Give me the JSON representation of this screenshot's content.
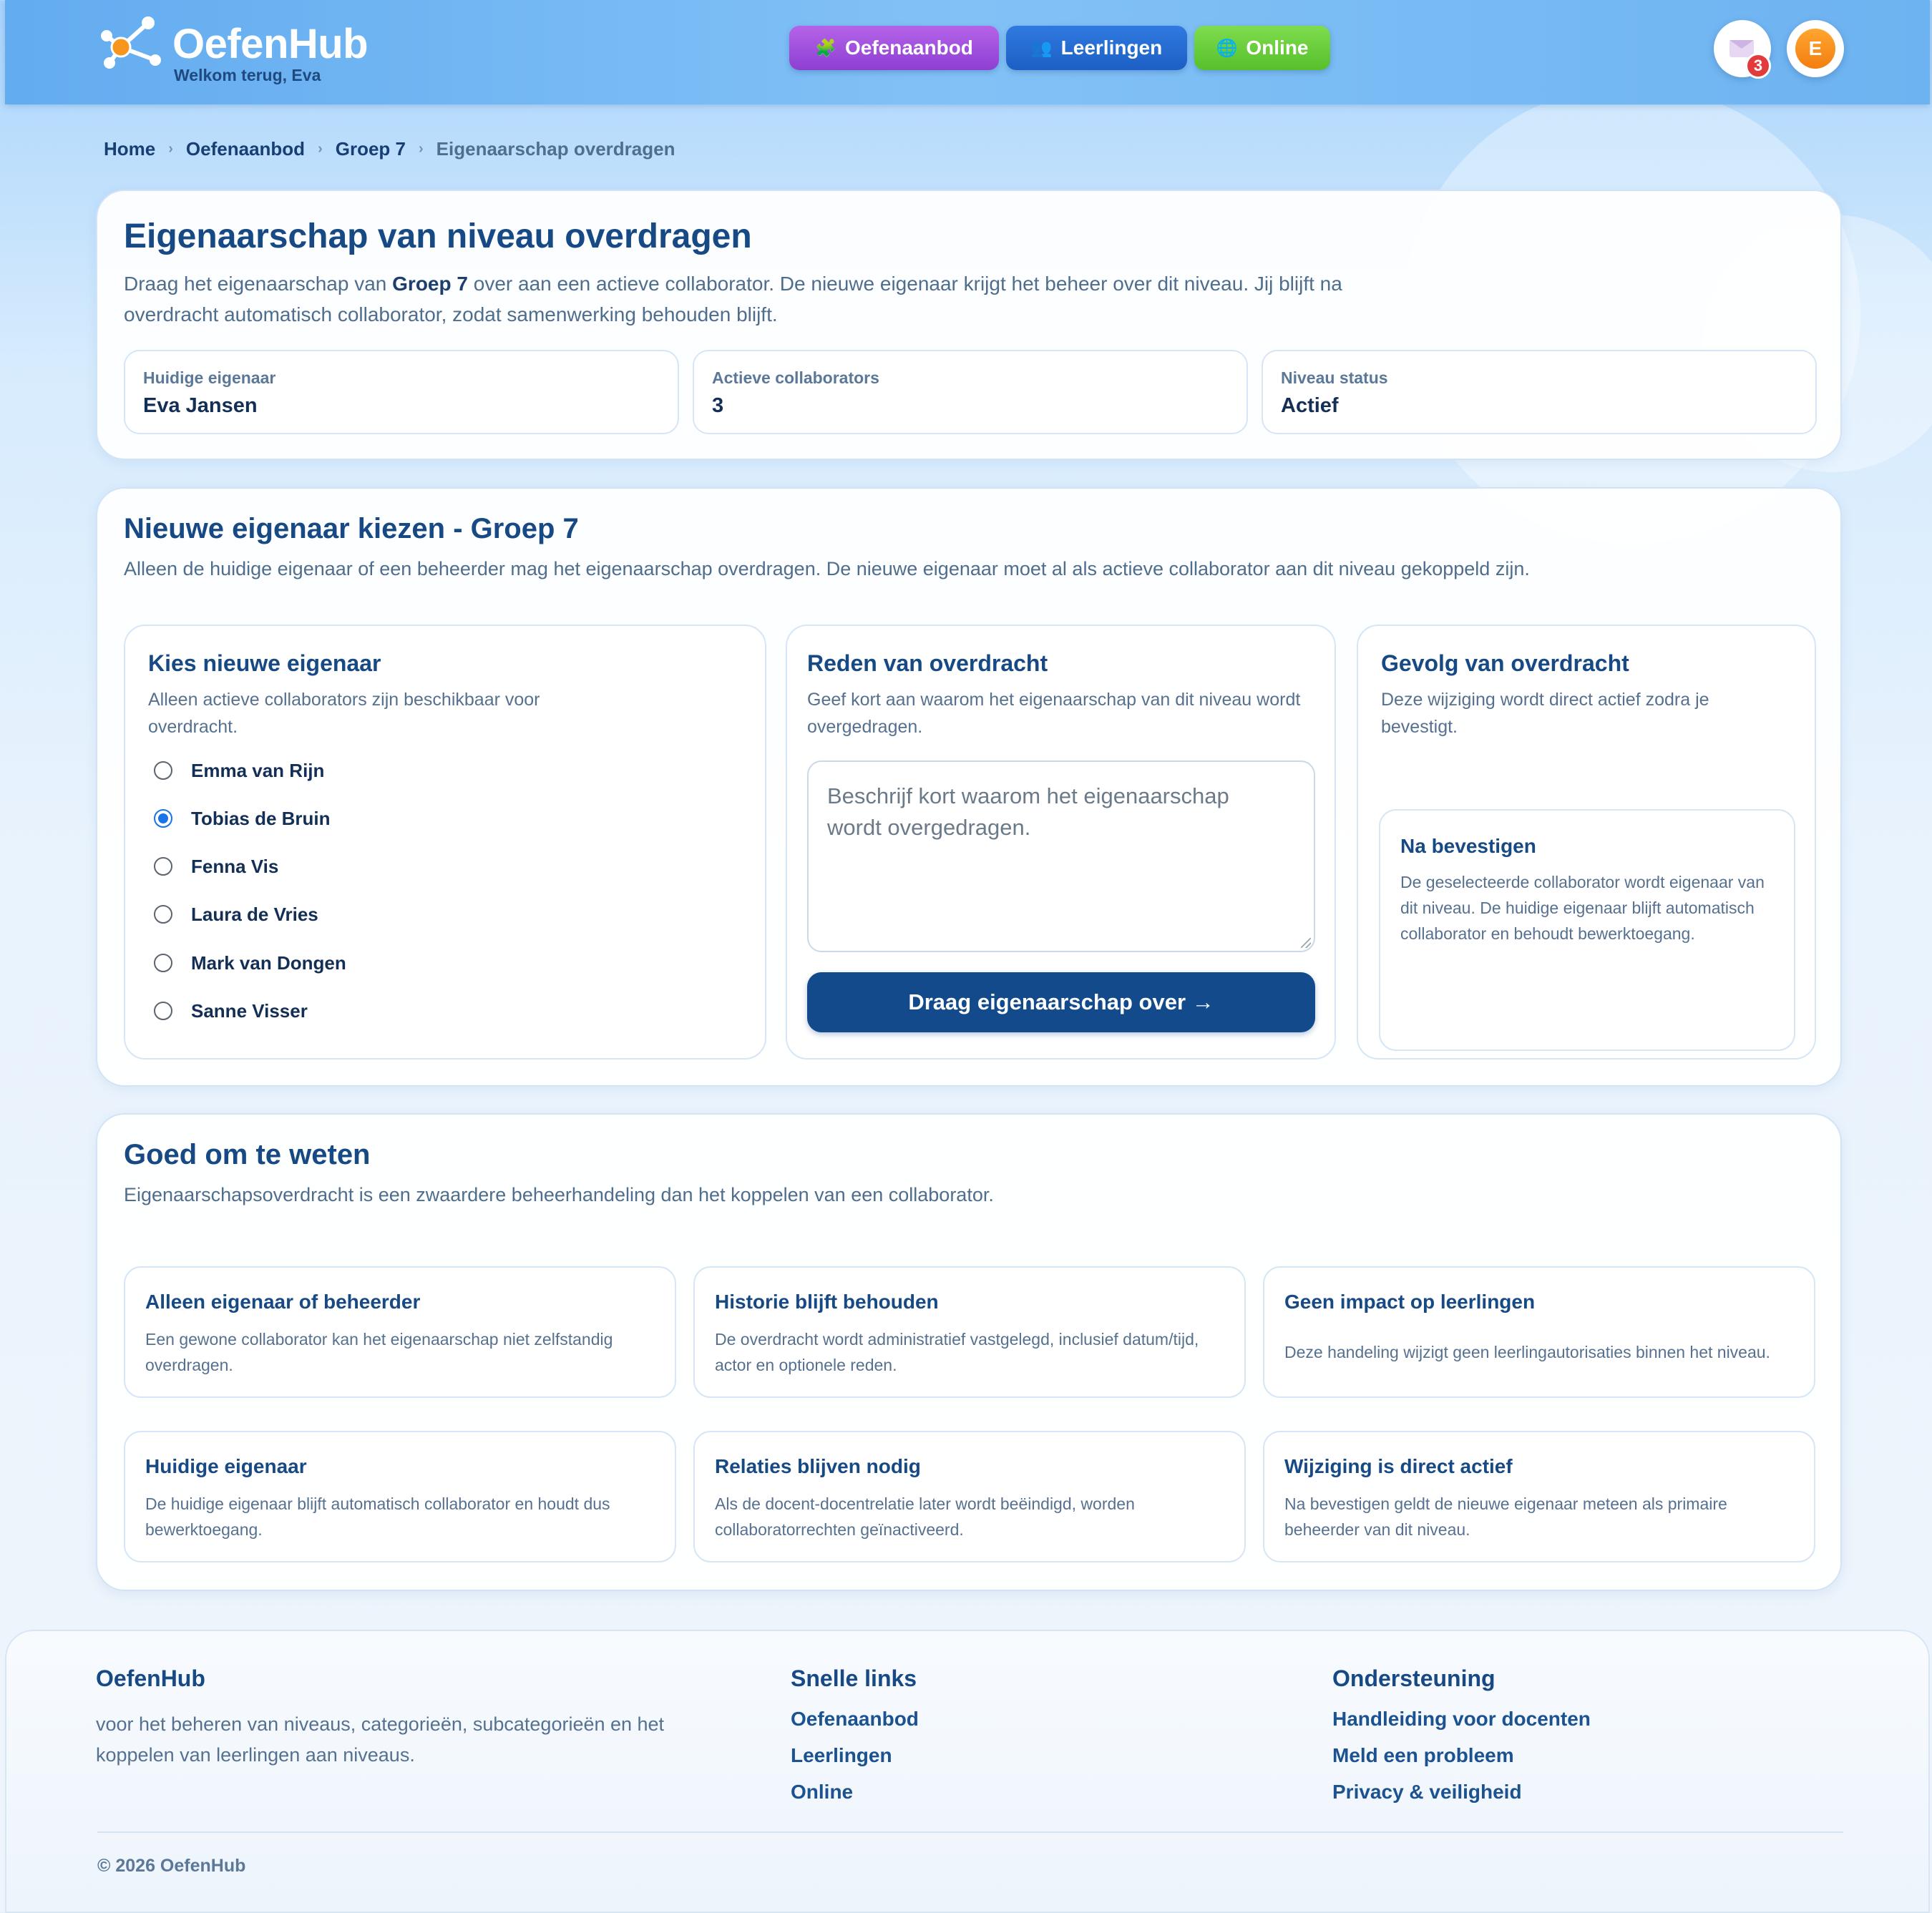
{
  "app": {
    "brand": "OefenHub",
    "welcome": "Welkom terug, Eva"
  },
  "nav": {
    "items": [
      {
        "label": "Oefenaanbod",
        "icon": "puzzle-icon",
        "color": "#a24fdd"
      },
      {
        "label": "Leerlingen",
        "icon": "users-icon",
        "color": "#2368d3"
      },
      {
        "label": "Online",
        "icon": "globe-icon",
        "color": "#66c937"
      }
    ],
    "mail_badge": "3",
    "avatar_initial": "E"
  },
  "breadcrumb": [
    "Home",
    "Oefenaanbod",
    "Groep 7",
    "Eigenaarschap overdragen"
  ],
  "overview": {
    "title": "Eigenaarschap van niveau overdragen",
    "intro_before": "Draag het eigenaarschap van ",
    "intro_bold": "Groep 7",
    "intro_after": " over aan een actieve collaborator. De nieuwe eigenaar krijgt het beheer over dit niveau. Jij blijft na overdracht automatisch collaborator, zodat samenwerking behouden blijft.",
    "stats": [
      {
        "label": "Huidige eigenaar",
        "value": "Eva Jansen"
      },
      {
        "label": "Actieve collaborators",
        "value": "3"
      },
      {
        "label": "Niveau status",
        "value": "Actief"
      }
    ]
  },
  "transfer": {
    "title": "Nieuwe eigenaar kiezen - Groep 7",
    "lead": "Alleen de huidige eigenaar of een beheerder mag het eigenaarschap overdragen. De nieuwe eigenaar moet al als actieve collaborator aan dit niveau gekoppeld zijn.",
    "choose": {
      "title": "Kies nieuwe eigenaar",
      "desc": "Alleen actieve collaborators zijn beschikbaar voor overdracht.",
      "selected": "Tobias de Bruin",
      "options": [
        "Emma van Rijn",
        "Tobias de Bruin",
        "Fenna Vis",
        "Laura de Vries",
        "Mark van Dongen",
        "Sanne Visser"
      ]
    },
    "reason": {
      "title": "Reden van overdracht",
      "desc": "Geef kort aan waarom het eigenaarschap van dit niveau wordt overgedragen.",
      "placeholder": "Beschrijf kort waarom het eigenaarschap wordt overgedragen.",
      "value": "",
      "button": "Draag eigenaarschap over →"
    },
    "consequence": {
      "title": "Gevolg van overdracht",
      "desc": "Deze wijziging wordt direct actief zodra je bevestigt.",
      "box_title": "Na bevestigen",
      "box_text": "De geselecteerde collaborator wordt eigenaar van dit niveau. De huidige eigenaar blijft automatisch collaborator en behoudt bewerktoegang."
    }
  },
  "info": {
    "title": "Goed om te weten",
    "lead": "Eigenaarschapsoverdracht is een zwaardere beheerhandeling dan het koppelen van een collaborator.",
    "tips": [
      {
        "title": "Alleen eigenaar of beheerder",
        "text": "Een gewone collaborator kan het eigenaarschap niet zelfstandig overdragen."
      },
      {
        "title": "Historie blijft behouden",
        "text": "De overdracht wordt administratief vastgelegd, inclusief datum/tijd, actor en optionele reden."
      },
      {
        "title": "Geen impact op leerlingen",
        "text": "Deze handeling wijzigt geen leerlingautorisaties binnen het niveau."
      },
      {
        "title": "Huidige eigenaar",
        "text": "De huidige eigenaar blijft automatisch collaborator en houdt dus bewerktoegang."
      },
      {
        "title": "Relaties blijven nodig",
        "text": "Als de docent-docentrelatie later wordt beëindigd, worden collaboratorrechten geïnactiveerd."
      },
      {
        "title": "Wijziging is direct actief",
        "text": "Na bevestigen geldt de nieuwe eigenaar meteen als primaire beheerder van dit niveau."
      }
    ]
  },
  "footer": {
    "brand": "OefenHub",
    "desc": "voor het beheren van niveaus, categorieën, subcategorieën en het koppelen van leerlingen aan niveaus.",
    "quick_title": "Snelle links",
    "quick_links": [
      "Oefenaanbod",
      "Leerlingen",
      "Online"
    ],
    "support_title": "Ondersteuning",
    "support_links": [
      "Handleiding voor docenten",
      "Meld een probleem",
      "Privacy & veiligheid"
    ],
    "copyright": "© 2026 OefenHub"
  }
}
